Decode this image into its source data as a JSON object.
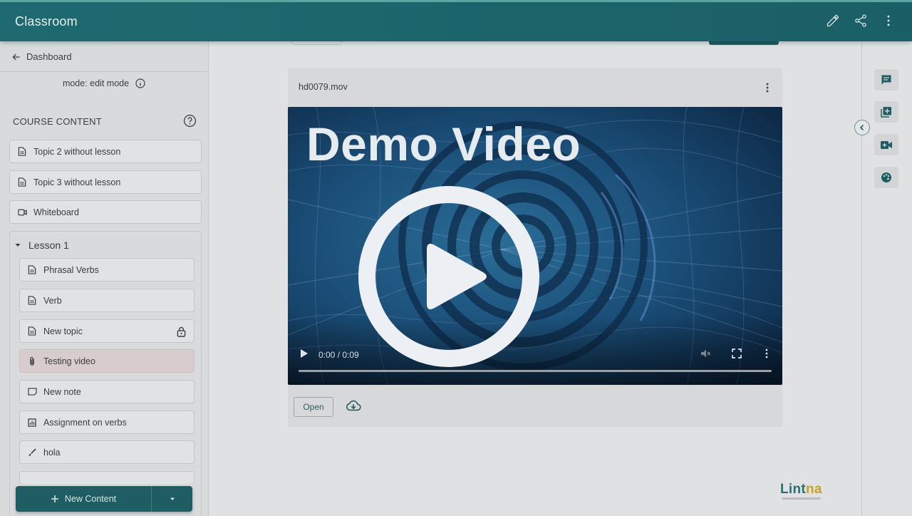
{
  "header": {
    "title": "Classroom",
    "icons": [
      "pencil-icon",
      "share-icon",
      "more-vertical-icon"
    ]
  },
  "sidebar": {
    "back_label": "Dashboard",
    "mode_label": "mode: edit mode",
    "section_title": "COURSE CONTENT",
    "items": [
      {
        "label": "Topic 2 without lesson",
        "icon": "document-icon"
      },
      {
        "label": "Topic 3 without lesson",
        "icon": "document-icon"
      },
      {
        "label": "Whiteboard",
        "icon": "video-icon"
      }
    ],
    "lesson": {
      "title": "Lesson 1",
      "items": [
        {
          "label": "Phrasal Verbs",
          "icon": "document-icon"
        },
        {
          "label": "Verb",
          "icon": "document-icon"
        },
        {
          "label": "New topic",
          "icon": "document-icon",
          "locked": true
        },
        {
          "label": "Testing video",
          "icon": "paperclip-icon",
          "active": true
        },
        {
          "label": "New note",
          "icon": "note-icon"
        },
        {
          "label": "Assignment on verbs",
          "icon": "chart-icon"
        },
        {
          "label": "hola",
          "icon": "brush-icon"
        }
      ]
    },
    "new_content_label": "New Content"
  },
  "main": {
    "file_name": "hd0079.mov",
    "video_overlay_title": "Demo Video",
    "player": {
      "time": "0:00 / 0:09",
      "progress": 0.0
    },
    "open_label": "Open",
    "brand": {
      "part1": "Lint",
      "part2": "na"
    }
  },
  "colors": {
    "header": "#1e6a70",
    "primary": "#1e5e63",
    "active_item": "#d9ccce",
    "brand_accent": "#c9a227"
  }
}
